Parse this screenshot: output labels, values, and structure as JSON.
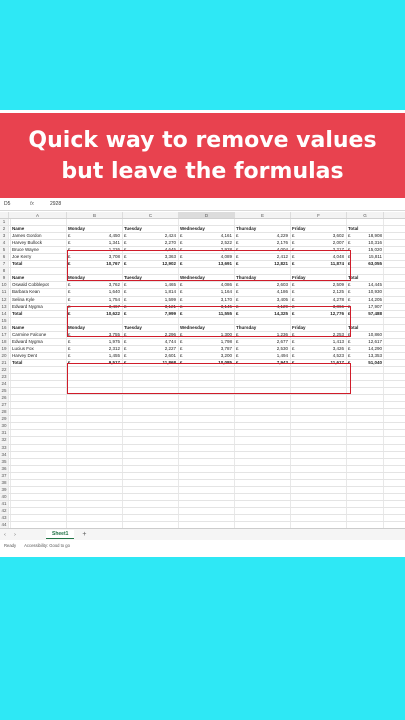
{
  "banner": {
    "line1": "Quick way to remove values",
    "line2": "but leave the formulas"
  },
  "formula_bar": {
    "cell_ref": "D5",
    "fx": "fx",
    "value": "2928"
  },
  "columns": [
    "A",
    "B",
    "C",
    "D",
    "E",
    "F",
    "G"
  ],
  "sheet_tab": "Sheet1",
  "status": {
    "ready": "Ready",
    "accessibility": "Accessibility: Good to go"
  },
  "currency": "£",
  "rows": [
    {
      "n": "1",
      "type": "blank"
    },
    {
      "n": "2",
      "type": "header",
      "cells": [
        "Name",
        "Monday",
        "Tuesday",
        "Wednesday",
        "Thursday",
        "Friday",
        "Total"
      ]
    },
    {
      "n": "3",
      "type": "data",
      "name": "James Gordon",
      "vals": [
        "4,450",
        "2,424",
        "4,161",
        "4,229",
        "3,602",
        "18,908"
      ]
    },
    {
      "n": "4",
      "type": "data",
      "name": "Harvey Bullock",
      "vals": [
        "1,341",
        "2,270",
        "2,522",
        "2,176",
        "2,007",
        "10,316"
      ]
    },
    {
      "n": "5",
      "type": "data",
      "name": "Bruce Wayne",
      "vals": [
        "1,226",
        "4,645",
        "2,928",
        "4,004",
        "2,217",
        "15,020"
      ]
    },
    {
      "n": "6",
      "type": "data",
      "name": "Joe Kerry",
      "vals": [
        "3,708",
        "3,363",
        "4,089",
        "2,412",
        "4,048",
        "15,811"
      ]
    },
    {
      "n": "7",
      "type": "total",
      "name": "Total",
      "vals": [
        "10,767",
        "12,902",
        "13,691",
        "12,821",
        "11,874",
        "63,055"
      ]
    },
    {
      "n": "8",
      "type": "blank"
    },
    {
      "n": "9",
      "type": "header",
      "cells": [
        "Name",
        "Monday",
        "Tuesday",
        "Wednesday",
        "Thursday",
        "Friday",
        "Total"
      ]
    },
    {
      "n": "10",
      "type": "data",
      "name": "Oswald Cobblepot",
      "vals": [
        "3,762",
        "1,465",
        "4,086",
        "2,603",
        "2,509",
        "14,445"
      ]
    },
    {
      "n": "11",
      "type": "data",
      "name": "Barbara Kean",
      "vals": [
        "1,640",
        "1,814",
        "1,164",
        "4,186",
        "2,125",
        "10,930"
      ]
    },
    {
      "n": "12",
      "type": "data",
      "name": "Selina Kyle",
      "vals": [
        "1,754",
        "1,599",
        "3,170",
        "3,405",
        "4,278",
        "14,205"
      ]
    },
    {
      "n": "13",
      "type": "data",
      "name": "Edward Nygma",
      "vals": [
        "3,467",
        "3,121",
        "3,145",
        "4,129",
        "3,866",
        "17,907"
      ]
    },
    {
      "n": "14",
      "type": "total",
      "name": "Total",
      "vals": [
        "10,622",
        "7,999",
        "11,555",
        "14,325",
        "12,776",
        "57,488"
      ]
    },
    {
      "n": "15",
      "type": "blank"
    },
    {
      "n": "16",
      "type": "header",
      "cells": [
        "Name",
        "Monday",
        "Tuesday",
        "Wednesday",
        "Thursday",
        "Friday",
        "Total"
      ]
    },
    {
      "n": "17",
      "type": "data",
      "name": "Carmine Falcone",
      "vals": [
        "3,755",
        "2,296",
        "1,300",
        "1,236",
        "2,253",
        "10,860"
      ]
    },
    {
      "n": "18",
      "type": "data",
      "name": "Edward Nygma",
      "vals": [
        "1,975",
        "4,744",
        "1,798",
        "2,677",
        "1,413",
        "12,617"
      ]
    },
    {
      "n": "19",
      "type": "data",
      "name": "Lucius Fox",
      "vals": [
        "2,312",
        "2,227",
        "3,787",
        "2,530",
        "3,426",
        "14,290"
      ]
    },
    {
      "n": "20",
      "type": "data",
      "name": "Harvey Dent",
      "vals": [
        "1,455",
        "2,601",
        "3,200",
        "1,494",
        "4,523",
        "13,353"
      ]
    },
    {
      "n": "21",
      "type": "total",
      "name": "Total",
      "vals": [
        "9,517",
        "11,868",
        "10,085",
        "7,943",
        "11,617",
        "51,040"
      ]
    },
    {
      "n": "22",
      "type": "blank"
    },
    {
      "n": "23",
      "type": "blank"
    },
    {
      "n": "24",
      "type": "blank"
    },
    {
      "n": "25",
      "type": "blank"
    },
    {
      "n": "26",
      "type": "blank"
    },
    {
      "n": "27",
      "type": "blank"
    },
    {
      "n": "28",
      "type": "blank"
    },
    {
      "n": "29",
      "type": "blank"
    },
    {
      "n": "30",
      "type": "blank"
    },
    {
      "n": "31",
      "type": "blank"
    },
    {
      "n": "32",
      "type": "blank"
    },
    {
      "n": "33",
      "type": "blank"
    },
    {
      "n": "34",
      "type": "blank"
    },
    {
      "n": "35",
      "type": "blank"
    },
    {
      "n": "36",
      "type": "blank"
    },
    {
      "n": "37",
      "type": "blank"
    },
    {
      "n": "38",
      "type": "blank"
    },
    {
      "n": "39",
      "type": "blank"
    },
    {
      "n": "40",
      "type": "blank"
    },
    {
      "n": "41",
      "type": "blank"
    },
    {
      "n": "42",
      "type": "blank"
    },
    {
      "n": "43",
      "type": "blank"
    },
    {
      "n": "44",
      "type": "blank"
    }
  ]
}
